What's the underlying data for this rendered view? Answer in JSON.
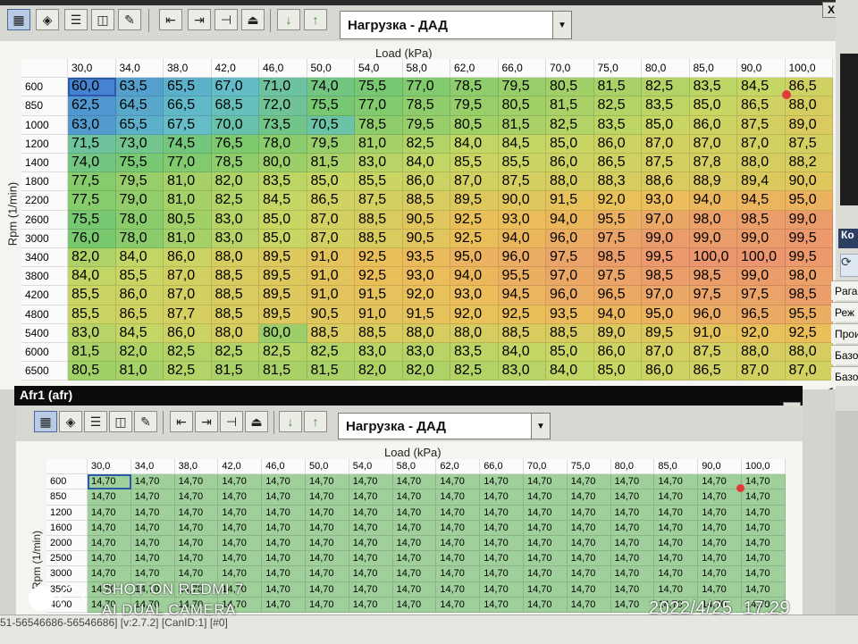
{
  "top_panel": {
    "selector_value": "Нагрузка - ДАД",
    "axis_title": "Load (kPa)",
    "yaxis_title": "Rpm (1/min)",
    "close_label": "X",
    "cols": [
      "30,0",
      "34,0",
      "38,0",
      "42,0",
      "46,0",
      "50,0",
      "54,0",
      "58,0",
      "62,0",
      "66,0",
      "70,0",
      "75,0",
      "80,0",
      "85,0",
      "90,0",
      "100,0"
    ],
    "rows": [
      {
        "rpm": "600",
        "vals": [
          "60,0",
          "63,5",
          "65,5",
          "67,0",
          "71,0",
          "74,0",
          "75,5",
          "77,0",
          "78,5",
          "79,5",
          "80,5",
          "81,5",
          "82,5",
          "83,5",
          "84,5",
          "86,5"
        ]
      },
      {
        "rpm": "850",
        "vals": [
          "62,5",
          "64,5",
          "66,5",
          "68,5",
          "72,0",
          "75,5",
          "77,0",
          "78,5",
          "79,5",
          "80,5",
          "81,5",
          "82,5",
          "83,5",
          "85,0",
          "86,5",
          "88,0"
        ]
      },
      {
        "rpm": "1000",
        "vals": [
          "63,0",
          "65,5",
          "67,5",
          "70,0",
          "73,5",
          "70,5",
          "78,5",
          "79,5",
          "80,5",
          "81,5",
          "82,5",
          "83,5",
          "85,0",
          "86,0",
          "87,5",
          "89,0"
        ]
      },
      {
        "rpm": "1200",
        "vals": [
          "71,5",
          "73,0",
          "74,5",
          "76,5",
          "78,0",
          "79,5",
          "81,0",
          "82,5",
          "84,0",
          "84,5",
          "85,0",
          "86,0",
          "87,0",
          "87,0",
          "87,0",
          "87,5"
        ]
      },
      {
        "rpm": "1400",
        "vals": [
          "74,0",
          "75,5",
          "77,0",
          "78,5",
          "80,0",
          "81,5",
          "83,0",
          "84,0",
          "85,5",
          "85,5",
          "86,0",
          "86,5",
          "87,5",
          "87,8",
          "88,0",
          "88,2"
        ]
      },
      {
        "rpm": "1800",
        "vals": [
          "77,5",
          "79,5",
          "81,0",
          "82,0",
          "83,5",
          "85,0",
          "85,5",
          "86,0",
          "87,0",
          "87,5",
          "88,0",
          "88,3",
          "88,6",
          "88,9",
          "89,4",
          "90,0"
        ]
      },
      {
        "rpm": "2200",
        "vals": [
          "77,5",
          "79,0",
          "81,0",
          "82,5",
          "84,5",
          "86,5",
          "87,5",
          "88,5",
          "89,5",
          "90,0",
          "91,5",
          "92,0",
          "93,0",
          "94,0",
          "94,5",
          "95,0"
        ]
      },
      {
        "rpm": "2600",
        "vals": [
          "75,5",
          "78,0",
          "80,5",
          "83,0",
          "85,0",
          "87,0",
          "88,5",
          "90,5",
          "92,5",
          "93,0",
          "94,0",
          "95,5",
          "97,0",
          "98,0",
          "98,5",
          "99,0"
        ]
      },
      {
        "rpm": "3000",
        "vals": [
          "76,0",
          "78,0",
          "81,0",
          "83,0",
          "85,0",
          "87,0",
          "88,5",
          "90,5",
          "92,5",
          "94,0",
          "96,0",
          "97,5",
          "99,0",
          "99,0",
          "99,0",
          "99,5"
        ]
      },
      {
        "rpm": "3400",
        "vals": [
          "82,0",
          "84,0",
          "86,0",
          "88,0",
          "89,5",
          "91,0",
          "92,5",
          "93,5",
          "95,0",
          "96,0",
          "97,5",
          "98,5",
          "99,5",
          "100,0",
          "100,0",
          "99,5"
        ]
      },
      {
        "rpm": "3800",
        "vals": [
          "84,0",
          "85,5",
          "87,0",
          "88,5",
          "89,5",
          "91,0",
          "92,5",
          "93,0",
          "94,0",
          "95,5",
          "97,0",
          "97,5",
          "98,5",
          "98,5",
          "99,0",
          "98,0"
        ]
      },
      {
        "rpm": "4200",
        "vals": [
          "85,5",
          "86,0",
          "87,0",
          "88,5",
          "89,5",
          "91,0",
          "91,5",
          "92,0",
          "93,0",
          "94,5",
          "96,0",
          "96,5",
          "97,0",
          "97,5",
          "97,5",
          "98,5"
        ]
      },
      {
        "rpm": "4800",
        "vals": [
          "85,5",
          "86,5",
          "87,7",
          "88,5",
          "89,5",
          "90,5",
          "91,0",
          "91,5",
          "92,0",
          "92,5",
          "93,5",
          "94,0",
          "95,0",
          "96,0",
          "96,5",
          "95,5"
        ]
      },
      {
        "rpm": "5400",
        "vals": [
          "83,0",
          "84,5",
          "86,0",
          "88,0",
          "80,0",
          "88,5",
          "88,5",
          "88,0",
          "88,0",
          "88,5",
          "88,5",
          "89,0",
          "89,5",
          "91,0",
          "92,0",
          "92,5"
        ]
      },
      {
        "rpm": "6000",
        "vals": [
          "81,5",
          "82,0",
          "82,5",
          "82,5",
          "82,5",
          "82,5",
          "83,0",
          "83,0",
          "83,5",
          "84,0",
          "85,0",
          "86,0",
          "87,0",
          "87,5",
          "88,0",
          "88,0"
        ]
      },
      {
        "rpm": "6500",
        "vals": [
          "80,5",
          "81,0",
          "82,5",
          "81,5",
          "81,5",
          "81,5",
          "82,0",
          "82,0",
          "82,5",
          "83,0",
          "84,0",
          "85,0",
          "86,0",
          "86,5",
          "87,0",
          "87,0"
        ]
      }
    ]
  },
  "bottom_panel": {
    "title": "Afr1 (afr)",
    "close_label": "X",
    "selector_value": "Нагрузка - ДАД",
    "axis_title": "Load (kPa)",
    "yaxis_title": "Rpm (1/min)",
    "cols": [
      "30,0",
      "34,0",
      "38,0",
      "42,0",
      "46,0",
      "50,0",
      "54,0",
      "58,0",
      "62,0",
      "66,0",
      "70,0",
      "75,0",
      "80,0",
      "85,0",
      "90,0",
      "100,0"
    ],
    "rpm": [
      "600",
      "850",
      "1200",
      "1600",
      "2000",
      "2500",
      "3000",
      "3500",
      "4000"
    ],
    "cell_value": "14,70"
  },
  "side_panel": {
    "header": "Ко",
    "items": [
      "Pага",
      "Реж",
      "Прои",
      "Базо",
      "Базов"
    ]
  },
  "status_bar": {
    "text": "51-56546686-56546686] [v:2.7.2] [CanID:1] [#0]"
  },
  "camera_overlay": {
    "line1": "SHOT ON REDMI 7",
    "line2": "AI DUAL CAMERA",
    "timestamp": "2022/4/25  17:29"
  }
}
